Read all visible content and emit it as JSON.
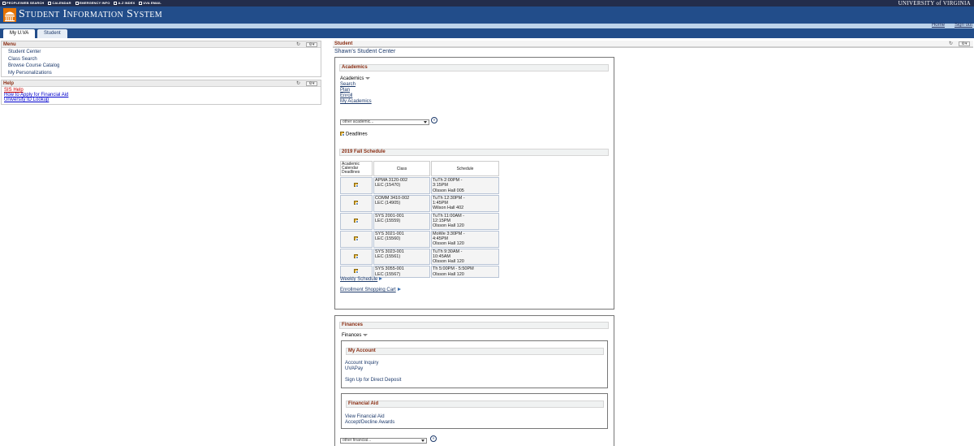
{
  "topbar": {
    "links": [
      "PEOPLE/WEB SEARCH",
      "CALENDAR",
      "EMERGENCY INFO",
      "A-Z INDEX",
      "UVA EMAIL"
    ],
    "university": "UNIVERSITY of VIRGINIA"
  },
  "header": {
    "title": "Student Information System"
  },
  "tabs": [
    {
      "label": "My U.VA"
    },
    {
      "label": "Student"
    }
  ],
  "util": {
    "home": "Home",
    "signout": "Sign out"
  },
  "menu": {
    "title": "Menu",
    "items": [
      "Student Center",
      "Class Search",
      "Browse Course Catalog",
      "My Personalizations"
    ]
  },
  "help": {
    "title": "Help",
    "items": [
      "SIS Help",
      "How to Apply for Financial Aid",
      "University ID Lookup"
    ]
  },
  "student": {
    "title": "Student",
    "center_title": "Shawn's Student Center"
  },
  "academics": {
    "header": "Academics",
    "dropdown_label": "Academics",
    "links": [
      "Search",
      "Plan",
      "Enroll",
      "My Academics"
    ],
    "select_value": "other academic...",
    "go": "»",
    "deadlines": "Deadlines"
  },
  "schedule": {
    "header": "2019 Fall Schedule",
    "columns": [
      "Academic Calendar Deadlines",
      "Class",
      "Schedule"
    ],
    "rows": [
      {
        "class1": "APMA 3120-002",
        "class2": "LEC (15470)",
        "s1": "TuTh 2:00PM -",
        "s2": "3:15PM",
        "s3": "Olsson Hall 005"
      },
      {
        "class1": "COMM 3410-002",
        "class2": "LEC (14905)",
        "s1": "TuTh 12:30PM -",
        "s2": "1:45PM",
        "s3": "Wilson Hall 402"
      },
      {
        "class1": "SYS 2001-001",
        "class2": "LEC (15559)",
        "s1": "TuTh 11:00AM -",
        "s2": "12:15PM",
        "s3": "Olsson Hall 120"
      },
      {
        "class1": "SYS 3021-001",
        "class2": "LEC (15560)",
        "s1": "MoWe 3:30PM -",
        "s2": "4:45PM",
        "s3": "Olsson Hall 120"
      },
      {
        "class1": "SYS 3023-001",
        "class2": "LEC (15561)",
        "s1": "TuTh 9:30AM -",
        "s2": "10:45AM",
        "s3": "Olsson Hall 120"
      },
      {
        "class1": "SYS 3055-001",
        "class2": "LEC (15567)",
        "s1": "Th 5:00PM - 5:50PM",
        "s2": "Olsson Hall 120",
        "s3": ""
      }
    ],
    "weekly": "Weekly Schedule",
    "cart": "Enrollment Shopping Cart"
  },
  "finances": {
    "header": "Finances",
    "dropdown_label": "Finances",
    "my_account": {
      "header": "My Account",
      "links": [
        "Account Inquiry",
        "UVAPay",
        "Sign Up for Direct Deposit"
      ]
    },
    "financial_aid": {
      "header": "Financial Aid",
      "links": [
        "View Financial Aid",
        "Accept/Decline Awards"
      ]
    },
    "select_value": "other financial...",
    "go": "»"
  },
  "colors": {
    "navy": "#232d4b",
    "banner": "#224d8a",
    "accent": "#8a2d12"
  }
}
